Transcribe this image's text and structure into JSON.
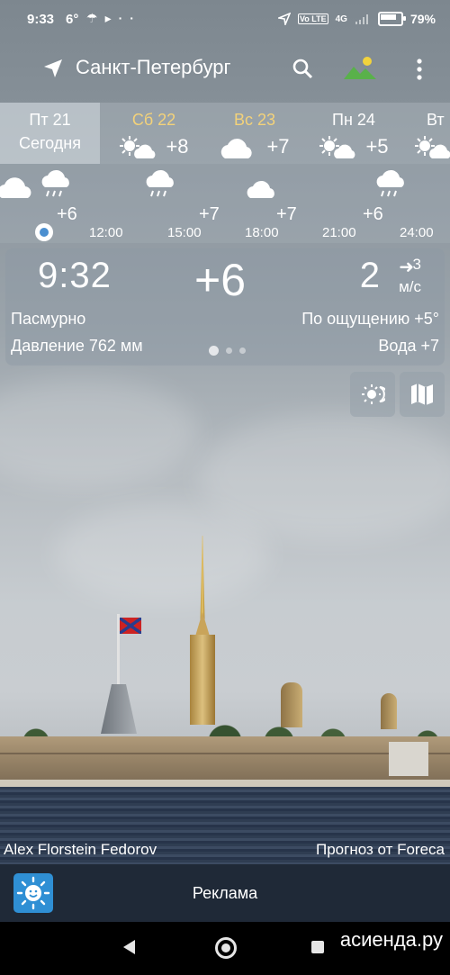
{
  "status_bar": {
    "time": "9:33",
    "temp": "6°",
    "battery": "79%",
    "network": "4G",
    "volte": "Vo LTE"
  },
  "app_bar": {
    "city": "Санкт-Петербург",
    "icons": [
      "location-arrow-icon",
      "search-icon",
      "landscape-icon",
      "more-vert-icon"
    ]
  },
  "days": [
    {
      "name": "Пт 21",
      "sub": "Сегодня",
      "active": true
    },
    {
      "name": "Сб 22",
      "temp": "+8",
      "icon": "sun-cloud-icon",
      "weekend": true
    },
    {
      "name": "Вс 23",
      "temp": "+7",
      "icon": "cloud-icon",
      "weekend": true
    },
    {
      "name": "Пн 24",
      "temp": "+5",
      "icon": "sun-cloud-icon"
    },
    {
      "name": "Вт",
      "icon": "sun-cloud-icon"
    }
  ],
  "hourly": {
    "icons": [
      "cloud-icon",
      "rain-cloud-icon",
      "rain-cloud-icon",
      "cloud-icon",
      "rain-cloud-icon"
    ],
    "temps": [
      "+6",
      "+7",
      "+7",
      "+6"
    ],
    "hours": [
      "12:00",
      "15:00",
      "18:00",
      "21:00",
      "24:00"
    ]
  },
  "current": {
    "time": "9:32",
    "temp": "+6",
    "wind_speed": "2",
    "wind_small": "3",
    "wind_unit": "м/с",
    "condition": "Пасмурно",
    "feels_like": "По ощущению +5°",
    "pressure": "Давление 762 мм",
    "water": "Вода +7"
  },
  "credits": {
    "photo_author": "Alex Florstein Fedorov",
    "forecast_source": "Прогноз от Foreca"
  },
  "ad": {
    "label": "Реклама"
  },
  "watermark": "асиенда.ру",
  "colors": {
    "weekend": "#f3d27a",
    "accent": "#4b8fd0",
    "ad_bar": "#1f2937"
  }
}
